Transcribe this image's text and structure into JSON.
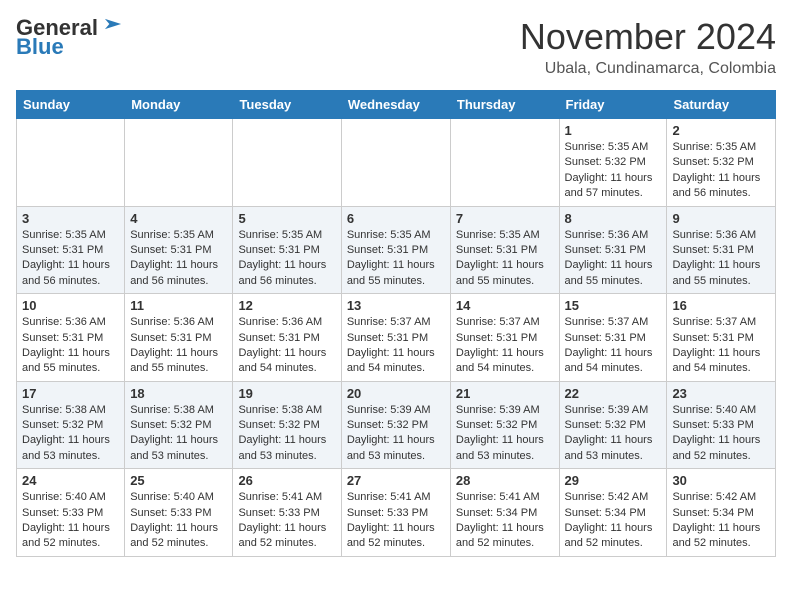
{
  "header": {
    "logo_line1": "General",
    "logo_line2": "Blue",
    "month": "November 2024",
    "location": "Ubala, Cundinamarca, Colombia"
  },
  "weekdays": [
    "Sunday",
    "Monday",
    "Tuesday",
    "Wednesday",
    "Thursday",
    "Friday",
    "Saturday"
  ],
  "weeks": [
    [
      {
        "day": "",
        "info": ""
      },
      {
        "day": "",
        "info": ""
      },
      {
        "day": "",
        "info": ""
      },
      {
        "day": "",
        "info": ""
      },
      {
        "day": "",
        "info": ""
      },
      {
        "day": "1",
        "info": "Sunrise: 5:35 AM\nSunset: 5:32 PM\nDaylight: 11 hours and 57 minutes."
      },
      {
        "day": "2",
        "info": "Sunrise: 5:35 AM\nSunset: 5:32 PM\nDaylight: 11 hours and 56 minutes."
      }
    ],
    [
      {
        "day": "3",
        "info": "Sunrise: 5:35 AM\nSunset: 5:31 PM\nDaylight: 11 hours and 56 minutes."
      },
      {
        "day": "4",
        "info": "Sunrise: 5:35 AM\nSunset: 5:31 PM\nDaylight: 11 hours and 56 minutes."
      },
      {
        "day": "5",
        "info": "Sunrise: 5:35 AM\nSunset: 5:31 PM\nDaylight: 11 hours and 56 minutes."
      },
      {
        "day": "6",
        "info": "Sunrise: 5:35 AM\nSunset: 5:31 PM\nDaylight: 11 hours and 55 minutes."
      },
      {
        "day": "7",
        "info": "Sunrise: 5:35 AM\nSunset: 5:31 PM\nDaylight: 11 hours and 55 minutes."
      },
      {
        "day": "8",
        "info": "Sunrise: 5:36 AM\nSunset: 5:31 PM\nDaylight: 11 hours and 55 minutes."
      },
      {
        "day": "9",
        "info": "Sunrise: 5:36 AM\nSunset: 5:31 PM\nDaylight: 11 hours and 55 minutes."
      }
    ],
    [
      {
        "day": "10",
        "info": "Sunrise: 5:36 AM\nSunset: 5:31 PM\nDaylight: 11 hours and 55 minutes."
      },
      {
        "day": "11",
        "info": "Sunrise: 5:36 AM\nSunset: 5:31 PM\nDaylight: 11 hours and 55 minutes."
      },
      {
        "day": "12",
        "info": "Sunrise: 5:36 AM\nSunset: 5:31 PM\nDaylight: 11 hours and 54 minutes."
      },
      {
        "day": "13",
        "info": "Sunrise: 5:37 AM\nSunset: 5:31 PM\nDaylight: 11 hours and 54 minutes."
      },
      {
        "day": "14",
        "info": "Sunrise: 5:37 AM\nSunset: 5:31 PM\nDaylight: 11 hours and 54 minutes."
      },
      {
        "day": "15",
        "info": "Sunrise: 5:37 AM\nSunset: 5:31 PM\nDaylight: 11 hours and 54 minutes."
      },
      {
        "day": "16",
        "info": "Sunrise: 5:37 AM\nSunset: 5:31 PM\nDaylight: 11 hours and 54 minutes."
      }
    ],
    [
      {
        "day": "17",
        "info": "Sunrise: 5:38 AM\nSunset: 5:32 PM\nDaylight: 11 hours and 53 minutes."
      },
      {
        "day": "18",
        "info": "Sunrise: 5:38 AM\nSunset: 5:32 PM\nDaylight: 11 hours and 53 minutes."
      },
      {
        "day": "19",
        "info": "Sunrise: 5:38 AM\nSunset: 5:32 PM\nDaylight: 11 hours and 53 minutes."
      },
      {
        "day": "20",
        "info": "Sunrise: 5:39 AM\nSunset: 5:32 PM\nDaylight: 11 hours and 53 minutes."
      },
      {
        "day": "21",
        "info": "Sunrise: 5:39 AM\nSunset: 5:32 PM\nDaylight: 11 hours and 53 minutes."
      },
      {
        "day": "22",
        "info": "Sunrise: 5:39 AM\nSunset: 5:32 PM\nDaylight: 11 hours and 53 minutes."
      },
      {
        "day": "23",
        "info": "Sunrise: 5:40 AM\nSunset: 5:33 PM\nDaylight: 11 hours and 52 minutes."
      }
    ],
    [
      {
        "day": "24",
        "info": "Sunrise: 5:40 AM\nSunset: 5:33 PM\nDaylight: 11 hours and 52 minutes."
      },
      {
        "day": "25",
        "info": "Sunrise: 5:40 AM\nSunset: 5:33 PM\nDaylight: 11 hours and 52 minutes."
      },
      {
        "day": "26",
        "info": "Sunrise: 5:41 AM\nSunset: 5:33 PM\nDaylight: 11 hours and 52 minutes."
      },
      {
        "day": "27",
        "info": "Sunrise: 5:41 AM\nSunset: 5:33 PM\nDaylight: 11 hours and 52 minutes."
      },
      {
        "day": "28",
        "info": "Sunrise: 5:41 AM\nSunset: 5:34 PM\nDaylight: 11 hours and 52 minutes."
      },
      {
        "day": "29",
        "info": "Sunrise: 5:42 AM\nSunset: 5:34 PM\nDaylight: 11 hours and 52 minutes."
      },
      {
        "day": "30",
        "info": "Sunrise: 5:42 AM\nSunset: 5:34 PM\nDaylight: 11 hours and 52 minutes."
      }
    ]
  ]
}
